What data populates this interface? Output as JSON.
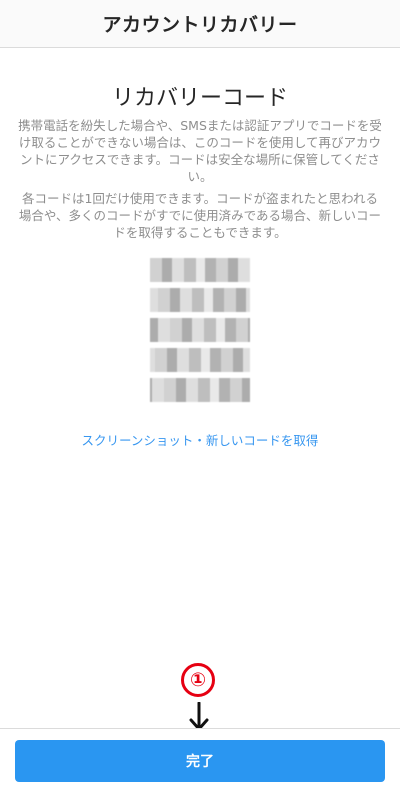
{
  "header": {
    "title": "アカウントリカバリー"
  },
  "main": {
    "heading": "リカバリーコード",
    "description_1": "携帯電話を紛失した場合や、SMSまたは認証アプリでコードを受け取ることができない場合は、このコードを使用して再びアカウントにアクセスできます。コードは安全な場所に保管してください。",
    "description_2": "各コードは1回だけ使用できます。コードが盗まれたと思われる場合や、多くのコードがすでに使用済みである場合、新しいコードを取得することもできます。",
    "codes": [
      "",
      "",
      "",
      "",
      ""
    ],
    "link_text": "スクリーンショット・新しいコードを取得"
  },
  "annotation": {
    "number": "①",
    "arrow": "down-arrow",
    "color": "#e60012"
  },
  "footer": {
    "done_label": "完了"
  },
  "colors": {
    "accent": "#3897f0",
    "button": "#2a96f1",
    "muted_text": "#8e8e8e"
  }
}
